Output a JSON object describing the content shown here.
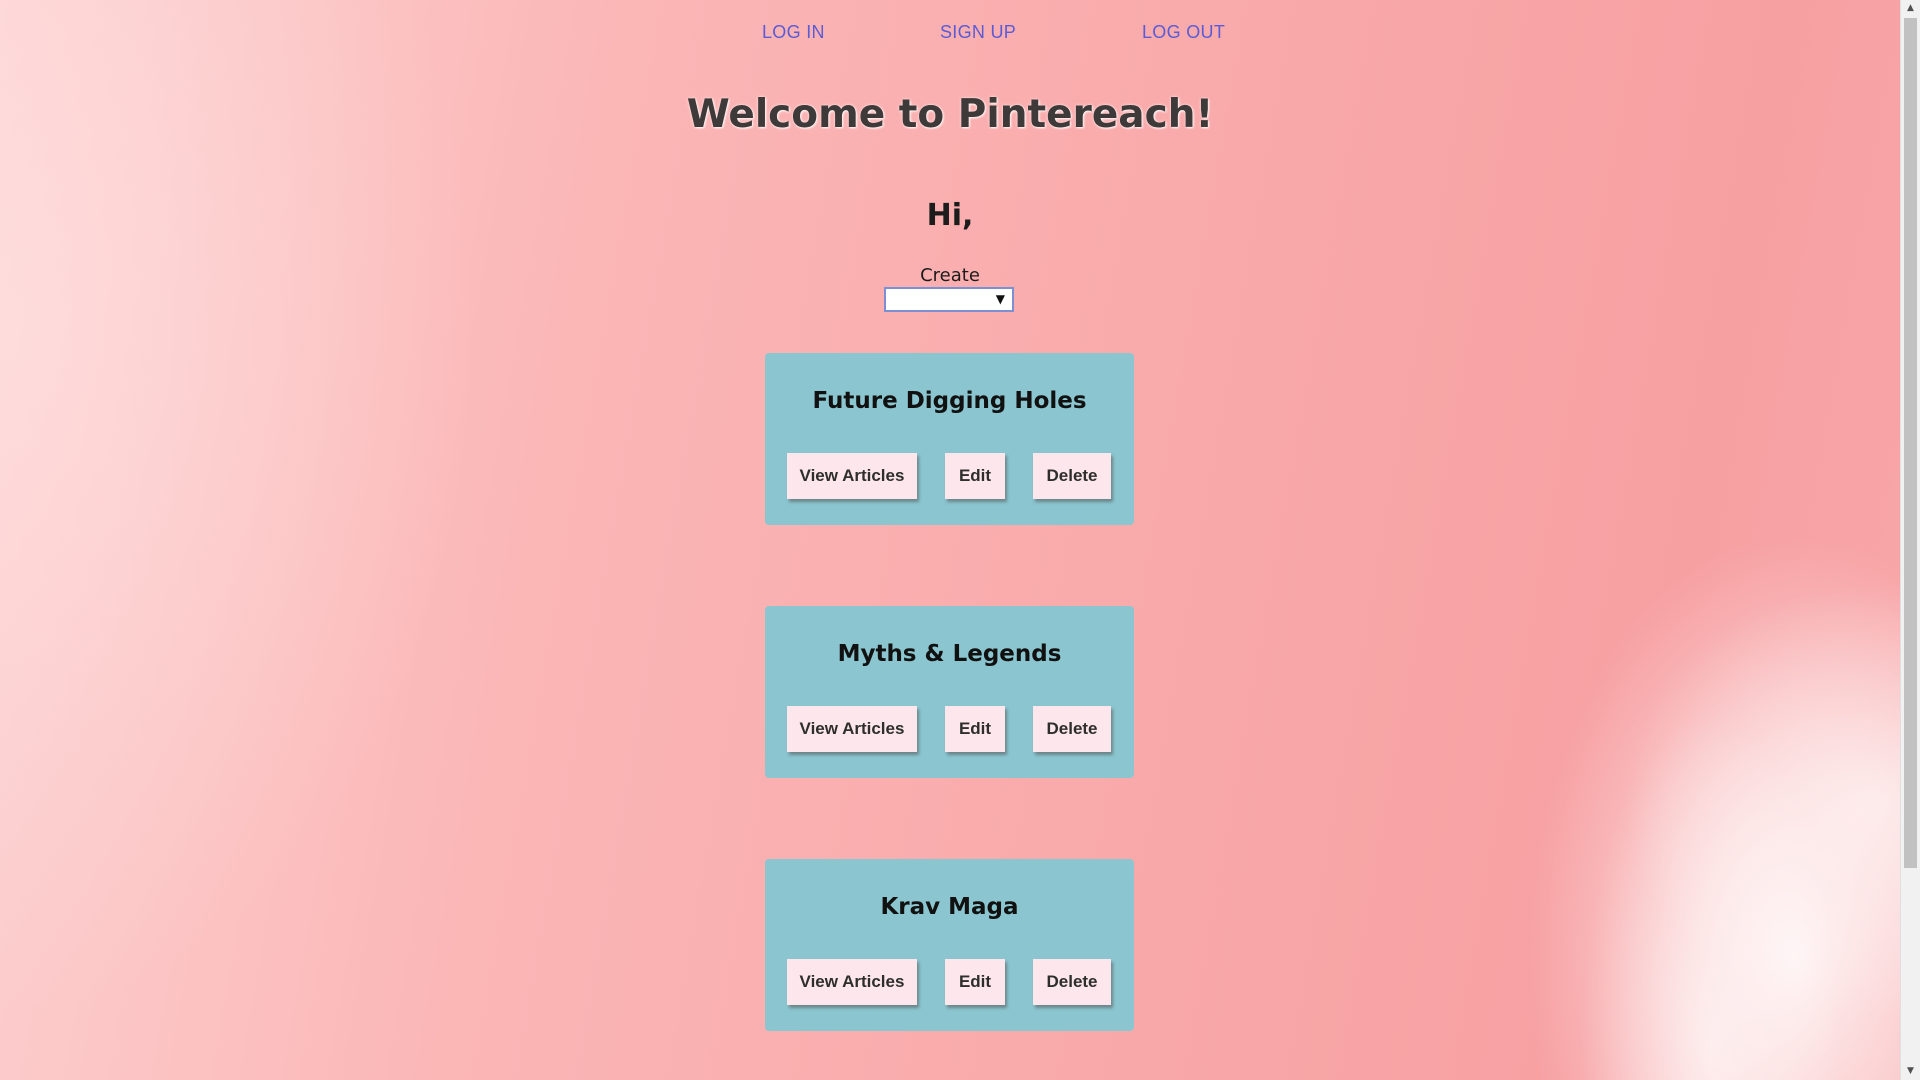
{
  "nav": {
    "login": "LOG IN",
    "signup": "SIGN UP",
    "logout": "LOG OUT"
  },
  "header": {
    "title": "Welcome to Pintereach!",
    "greeting": "Hi,"
  },
  "create": {
    "label": "Create",
    "selected": "",
    "caret": "▼"
  },
  "boards": [
    {
      "title": "Future Digging Holes",
      "view_label": "View Articles",
      "edit_label": "Edit",
      "delete_label": "Delete"
    },
    {
      "title": "Myths & Legends",
      "view_label": "View Articles",
      "edit_label": "Edit",
      "delete_label": "Delete"
    },
    {
      "title": "Krav Maga",
      "view_label": "View Articles",
      "edit_label": "Edit",
      "delete_label": "Delete"
    }
  ],
  "scrollbar": {
    "up": "▲",
    "down": "▼"
  },
  "colors": {
    "card": "#8bc6d0",
    "button": "#fde7ec",
    "nav_link": "#5b5bd6"
  }
}
